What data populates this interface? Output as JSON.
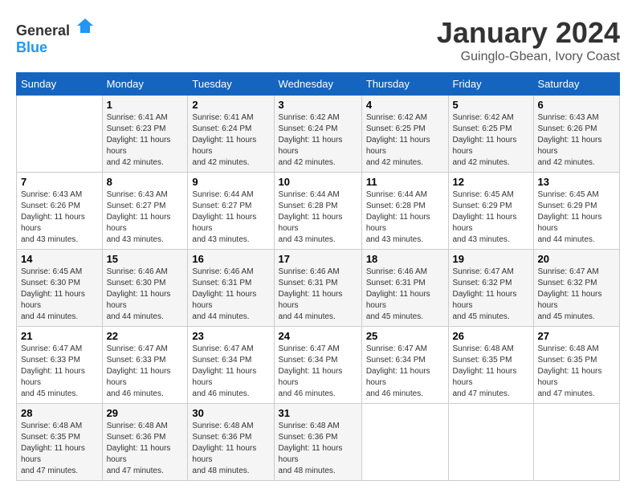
{
  "logo": {
    "general": "General",
    "blue": "Blue"
  },
  "title": "January 2024",
  "subtitle": "Guinglo-Gbean, Ivory Coast",
  "days_of_week": [
    "Sunday",
    "Monday",
    "Tuesday",
    "Wednesday",
    "Thursday",
    "Friday",
    "Saturday"
  ],
  "weeks": [
    [
      {
        "day": "",
        "sunrise": "",
        "sunset": "",
        "daylight": ""
      },
      {
        "day": "1",
        "sunrise": "Sunrise: 6:41 AM",
        "sunset": "Sunset: 6:23 PM",
        "daylight": "Daylight: 11 hours and 42 minutes."
      },
      {
        "day": "2",
        "sunrise": "Sunrise: 6:41 AM",
        "sunset": "Sunset: 6:24 PM",
        "daylight": "Daylight: 11 hours and 42 minutes."
      },
      {
        "day": "3",
        "sunrise": "Sunrise: 6:42 AM",
        "sunset": "Sunset: 6:24 PM",
        "daylight": "Daylight: 11 hours and 42 minutes."
      },
      {
        "day": "4",
        "sunrise": "Sunrise: 6:42 AM",
        "sunset": "Sunset: 6:25 PM",
        "daylight": "Daylight: 11 hours and 42 minutes."
      },
      {
        "day": "5",
        "sunrise": "Sunrise: 6:42 AM",
        "sunset": "Sunset: 6:25 PM",
        "daylight": "Daylight: 11 hours and 42 minutes."
      },
      {
        "day": "6",
        "sunrise": "Sunrise: 6:43 AM",
        "sunset": "Sunset: 6:26 PM",
        "daylight": "Daylight: 11 hours and 42 minutes."
      }
    ],
    [
      {
        "day": "7",
        "sunrise": "Sunrise: 6:43 AM",
        "sunset": "Sunset: 6:26 PM",
        "daylight": "Daylight: 11 hours and 43 minutes."
      },
      {
        "day": "8",
        "sunrise": "Sunrise: 6:43 AM",
        "sunset": "Sunset: 6:27 PM",
        "daylight": "Daylight: 11 hours and 43 minutes."
      },
      {
        "day": "9",
        "sunrise": "Sunrise: 6:44 AM",
        "sunset": "Sunset: 6:27 PM",
        "daylight": "Daylight: 11 hours and 43 minutes."
      },
      {
        "day": "10",
        "sunrise": "Sunrise: 6:44 AM",
        "sunset": "Sunset: 6:28 PM",
        "daylight": "Daylight: 11 hours and 43 minutes."
      },
      {
        "day": "11",
        "sunrise": "Sunrise: 6:44 AM",
        "sunset": "Sunset: 6:28 PM",
        "daylight": "Daylight: 11 hours and 43 minutes."
      },
      {
        "day": "12",
        "sunrise": "Sunrise: 6:45 AM",
        "sunset": "Sunset: 6:29 PM",
        "daylight": "Daylight: 11 hours and 43 minutes."
      },
      {
        "day": "13",
        "sunrise": "Sunrise: 6:45 AM",
        "sunset": "Sunset: 6:29 PM",
        "daylight": "Daylight: 11 hours and 44 minutes."
      }
    ],
    [
      {
        "day": "14",
        "sunrise": "Sunrise: 6:45 AM",
        "sunset": "Sunset: 6:30 PM",
        "daylight": "Daylight: 11 hours and 44 minutes."
      },
      {
        "day": "15",
        "sunrise": "Sunrise: 6:46 AM",
        "sunset": "Sunset: 6:30 PM",
        "daylight": "Daylight: 11 hours and 44 minutes."
      },
      {
        "day": "16",
        "sunrise": "Sunrise: 6:46 AM",
        "sunset": "Sunset: 6:31 PM",
        "daylight": "Daylight: 11 hours and 44 minutes."
      },
      {
        "day": "17",
        "sunrise": "Sunrise: 6:46 AM",
        "sunset": "Sunset: 6:31 PM",
        "daylight": "Daylight: 11 hours and 44 minutes."
      },
      {
        "day": "18",
        "sunrise": "Sunrise: 6:46 AM",
        "sunset": "Sunset: 6:31 PM",
        "daylight": "Daylight: 11 hours and 45 minutes."
      },
      {
        "day": "19",
        "sunrise": "Sunrise: 6:47 AM",
        "sunset": "Sunset: 6:32 PM",
        "daylight": "Daylight: 11 hours and 45 minutes."
      },
      {
        "day": "20",
        "sunrise": "Sunrise: 6:47 AM",
        "sunset": "Sunset: 6:32 PM",
        "daylight": "Daylight: 11 hours and 45 minutes."
      }
    ],
    [
      {
        "day": "21",
        "sunrise": "Sunrise: 6:47 AM",
        "sunset": "Sunset: 6:33 PM",
        "daylight": "Daylight: 11 hours and 45 minutes."
      },
      {
        "day": "22",
        "sunrise": "Sunrise: 6:47 AM",
        "sunset": "Sunset: 6:33 PM",
        "daylight": "Daylight: 11 hours and 46 minutes."
      },
      {
        "day": "23",
        "sunrise": "Sunrise: 6:47 AM",
        "sunset": "Sunset: 6:34 PM",
        "daylight": "Daylight: 11 hours and 46 minutes."
      },
      {
        "day": "24",
        "sunrise": "Sunrise: 6:47 AM",
        "sunset": "Sunset: 6:34 PM",
        "daylight": "Daylight: 11 hours and 46 minutes."
      },
      {
        "day": "25",
        "sunrise": "Sunrise: 6:47 AM",
        "sunset": "Sunset: 6:34 PM",
        "daylight": "Daylight: 11 hours and 46 minutes."
      },
      {
        "day": "26",
        "sunrise": "Sunrise: 6:48 AM",
        "sunset": "Sunset: 6:35 PM",
        "daylight": "Daylight: 11 hours and 47 minutes."
      },
      {
        "day": "27",
        "sunrise": "Sunrise: 6:48 AM",
        "sunset": "Sunset: 6:35 PM",
        "daylight": "Daylight: 11 hours and 47 minutes."
      }
    ],
    [
      {
        "day": "28",
        "sunrise": "Sunrise: 6:48 AM",
        "sunset": "Sunset: 6:35 PM",
        "daylight": "Daylight: 11 hours and 47 minutes."
      },
      {
        "day": "29",
        "sunrise": "Sunrise: 6:48 AM",
        "sunset": "Sunset: 6:36 PM",
        "daylight": "Daylight: 11 hours and 47 minutes."
      },
      {
        "day": "30",
        "sunrise": "Sunrise: 6:48 AM",
        "sunset": "Sunset: 6:36 PM",
        "daylight": "Daylight: 11 hours and 48 minutes."
      },
      {
        "day": "31",
        "sunrise": "Sunrise: 6:48 AM",
        "sunset": "Sunset: 6:36 PM",
        "daylight": "Daylight: 11 hours and 48 minutes."
      },
      {
        "day": "",
        "sunrise": "",
        "sunset": "",
        "daylight": ""
      },
      {
        "day": "",
        "sunrise": "",
        "sunset": "",
        "daylight": ""
      },
      {
        "day": "",
        "sunrise": "",
        "sunset": "",
        "daylight": ""
      }
    ]
  ]
}
